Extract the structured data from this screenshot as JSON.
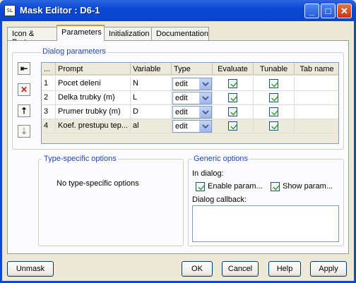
{
  "window": {
    "title": "Mask Editor : D6-1",
    "icon": "simulink-app-icon"
  },
  "tabs": [
    {
      "label": "Icon & Ports"
    },
    {
      "label": "Parameters"
    },
    {
      "label": "Initialization"
    },
    {
      "label": "Documentation"
    }
  ],
  "dialog_parameters": {
    "label": "Dialog parameters",
    "columns": [
      "...",
      "Prompt",
      "Variable",
      "Type",
      "Evaluate",
      "Tunable",
      "Tab name"
    ],
    "rows": [
      {
        "index": "1",
        "prompt": "Pocet deleni",
        "variable": "N",
        "type": "edit",
        "evaluate": true,
        "tunable": true,
        "tab": ""
      },
      {
        "index": "2",
        "prompt": "Delka trubky (m)",
        "variable": "L",
        "type": "edit",
        "evaluate": true,
        "tunable": true,
        "tab": ""
      },
      {
        "index": "3",
        "prompt": "Prumer trubky (m)",
        "variable": "D",
        "type": "edit",
        "evaluate": true,
        "tunable": true,
        "tab": ""
      },
      {
        "index": "4",
        "prompt": "Koef. prestupu tep...",
        "variable": "al",
        "type": "edit",
        "evaluate": true,
        "tunable": true,
        "tab": ""
      }
    ]
  },
  "type_specific": {
    "label": "Type-specific options",
    "text": "No type-specific options"
  },
  "generic": {
    "label": "Generic options",
    "in_dialog": "In dialog:",
    "enable_param": "Enable param...",
    "show_param": "Show param...",
    "enable_checked": true,
    "show_checked": true,
    "callback_label": "Dialog callback:",
    "callback_value": ""
  },
  "buttons": {
    "unmask": "Unmask",
    "ok": "OK",
    "cancel": "Cancel",
    "help": "Help",
    "apply": "Apply"
  }
}
